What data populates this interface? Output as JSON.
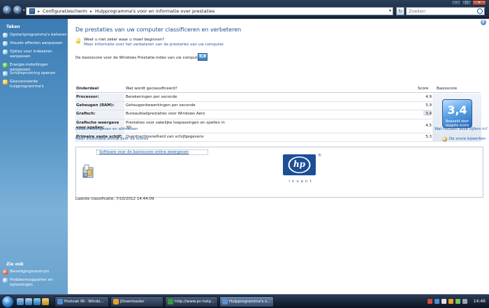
{
  "address_bar": {
    "crumb_1": "Configuratiescherm",
    "crumb_2": "Hulpprogramma's voor en informatie over prestaties",
    "search_placeholder": "Zoeken"
  },
  "task_pane": {
    "tasks_heading": "Taken",
    "tasks": [
      {
        "label": "Opstartprogramma's beheren",
        "icon": "startup-icon"
      },
      {
        "label": "Visuele effecten aanpassen",
        "icon": "effects-icon"
      },
      {
        "label": "Opties voor indexeren aanpassen",
        "icon": "index-icon"
      },
      {
        "label": "Energie-instellingen aanpassen",
        "icon": "power-icon"
      },
      {
        "label": "Schijfopruiming openen",
        "icon": "disk-cleanup-icon"
      },
      {
        "label": "Geavanceerde hulpprogramma's",
        "icon": "tools-icon"
      }
    ],
    "see_also_heading": "Zie ook",
    "see_also": [
      {
        "label": "Beveiligingscentrum",
        "icon": "shield-icon"
      },
      {
        "label": "Probleemrapporten en oplossingen",
        "icon": "report-icon"
      }
    ]
  },
  "main": {
    "title": "De prestaties van uw computer classificeren en verbeteren",
    "hint_title": "Weet u niet zeker waar u moet beginnen?",
    "hint_link": "Meer informatie over het verbeteren van de prestaties van uw computer.",
    "base_line": "De basisscore voor de Windows Prestatie-index van uw computer is",
    "base_badge": "3,4",
    "table": {
      "col_component": "Onderdeel",
      "col_rated": "Wat wordt geclassificeerd?",
      "col_score": "Score",
      "col_base": "Basisscore",
      "rows": [
        {
          "component": "Processor:",
          "rated": "Berekeningen per seconde",
          "score": "4,9"
        },
        {
          "component": "Geheugen (RAM):",
          "rated": "Geheugenbewerkingen per seconde",
          "score": "5,9"
        },
        {
          "component": "Grafisch:",
          "rated": "Bureaubladprestaties voor Windows Aero",
          "score": "3,4"
        },
        {
          "component": "Grafische weergave voor spellen:",
          "rated": "Prestaties voor zakelijke toepassingen en spellen in 3D",
          "score": "4,5"
        },
        {
          "component": "Primaire vaste schijf:",
          "rated": "Overdrachtssnelheid van schijfgegevens",
          "score": "5,3"
        }
      ],
      "base_score": "3,4",
      "base_caption": "Bepaald door laagste score"
    },
    "link_details": "Details weergeven en afdrukken",
    "link_what_mean": "Wat houden deze cijfers in?",
    "link_more_info": "Meer informatie online over de scores",
    "link_update": "De score bijwerken",
    "oem": {
      "link": "Software voor de basisscore online weergeven",
      "logo_text": "hp",
      "logo_reg": "®",
      "logo_tagline": "invent"
    },
    "last_classification": "Laatste classificatie: 7/10/2012 14:44:09"
  },
  "taskbar": {
    "buttons": [
      {
        "label": "Postvak IN - Windo...",
        "icon": "mail-icon",
        "color": "#4a8fd8"
      },
      {
        "label": "JDownloader",
        "icon": "download-icon",
        "color": "#e6a22a"
      },
      {
        "label": "http://www.pc-help...",
        "icon": "browser-icon",
        "color": "#3a9a3a"
      },
      {
        "label": "Hulpprogramma's v...",
        "icon": "control-panel-icon",
        "color": "#5c8fcf"
      }
    ],
    "clock": "14:46"
  }
}
